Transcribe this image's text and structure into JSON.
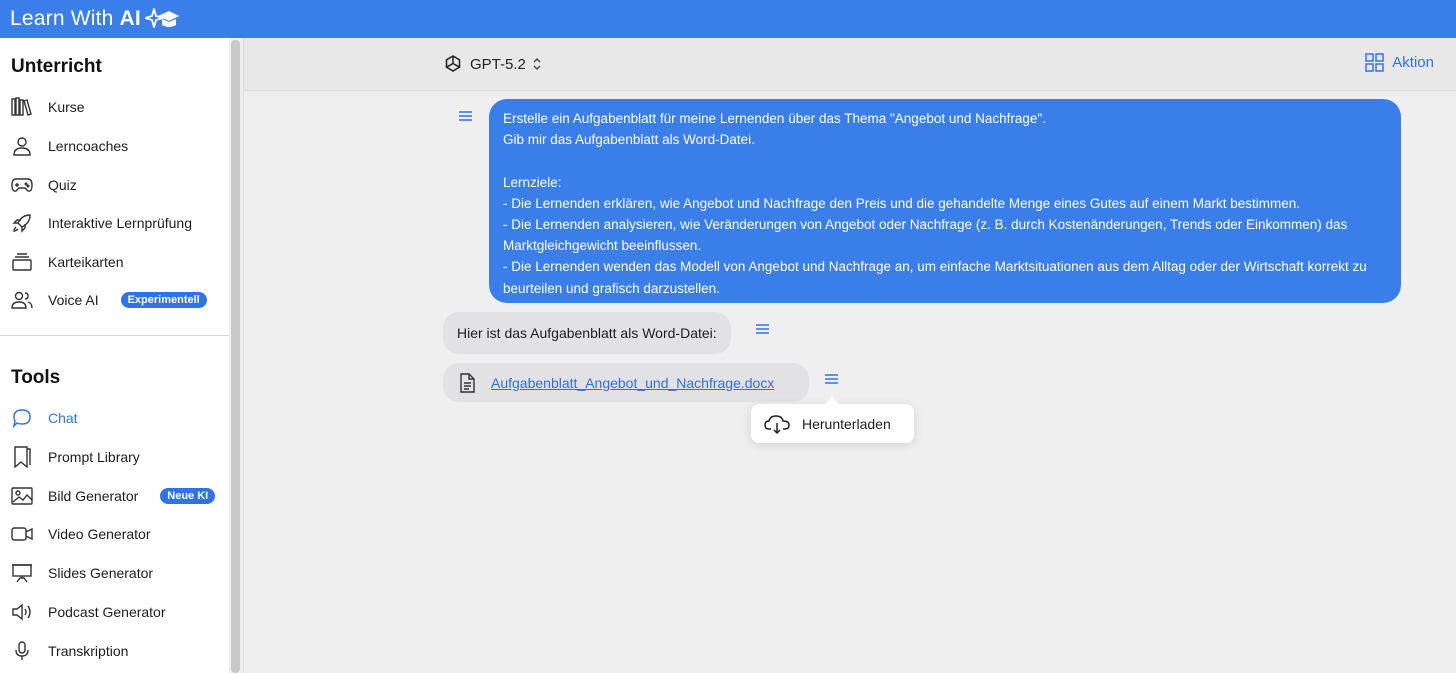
{
  "app": {
    "title": "Learn With",
    "title_bold": "AI"
  },
  "sidebar": {
    "section1_title": "Unterricht",
    "section1_items": [
      {
        "label": "Kurse",
        "icon": "books-icon"
      },
      {
        "label": "Lerncoaches",
        "icon": "person-icon"
      },
      {
        "label": "Quiz",
        "icon": "gamepad-icon"
      },
      {
        "label": "Interaktive Lernprüfung",
        "icon": "rocket-icon"
      },
      {
        "label": "Karteikarten",
        "icon": "cards-icon"
      },
      {
        "label": "Voice AI",
        "icon": "people-icon",
        "badge": "Experimentell"
      }
    ],
    "section2_title": "Tools",
    "section2_items": [
      {
        "label": "Chat",
        "icon": "chat-bubble-icon",
        "active": true
      },
      {
        "label": "Prompt Library",
        "icon": "bookmark-icon"
      },
      {
        "label": "Bild Generator",
        "icon": "image-icon",
        "badge": "Neue KI"
      },
      {
        "label": "Video Generator",
        "icon": "video-icon"
      },
      {
        "label": "Slides Generator",
        "icon": "presentation-icon"
      },
      {
        "label": "Podcast Generator",
        "icon": "speaker-icon"
      },
      {
        "label": "Transkription",
        "icon": "microphone-icon"
      }
    ]
  },
  "header": {
    "model": "GPT-5.2",
    "action": "Aktion"
  },
  "chat": {
    "user_message": "Erstelle ein Aufgabenblatt für meine Lernenden über das Thema \"Angebot und Nachfrage\".\nGib mir das Aufgabenblatt als Word-Datei.\n\nLernziele:\n- Die Lernenden erklären, wie Angebot und Nachfrage den Preis und die gehandelte Menge eines Gutes auf einem Markt bestimmen.\n- Die Lernenden analysieren, wie Veränderungen von Angebot oder Nachfrage (z. B. durch Kostenänderungen, Trends oder Einkommen) das Marktgleichgewicht beeinflussen.\n- Die Lernenden wenden das Modell von Angebot und Nachfrage an, um einfache Marktsituationen aus dem Alltag oder der Wirtschaft korrekt zu beurteilen und grafisch darzustellen.",
    "ai_message": "Hier ist das Aufgabenblatt als Word-Datei:",
    "file_name": "Aufgabenblatt_Angebot_und_Nachfrage.docx",
    "download_label": "Herunterladen"
  },
  "colors": {
    "accent": "#3a7eea",
    "link": "#2f6fd6",
    "background": "#efefef"
  }
}
